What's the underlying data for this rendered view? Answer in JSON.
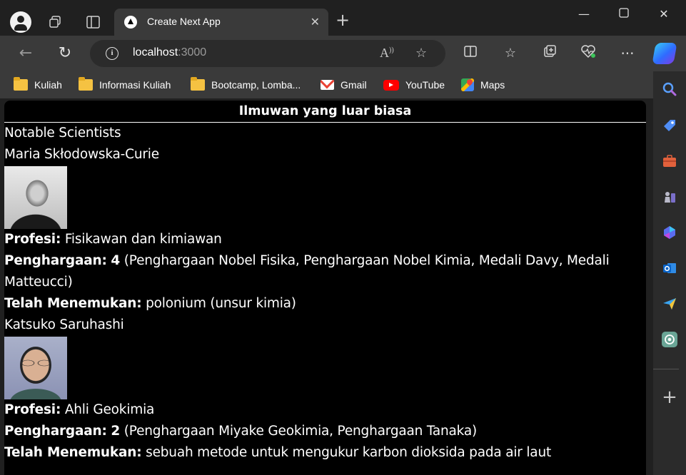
{
  "browser": {
    "tab_title": "Create Next App",
    "url_host": "localhost",
    "url_port": ":3000",
    "bookmarks": [
      {
        "label": "Kuliah",
        "icon": "folder-icon"
      },
      {
        "label": "Informasi Kuliah",
        "icon": "folder-icon"
      },
      {
        "label": "Bootcamp, Lomba...",
        "icon": "folder-icon"
      },
      {
        "label": "Gmail",
        "icon": "gmail-icon"
      },
      {
        "label": "YouTube",
        "icon": "youtube-icon"
      },
      {
        "label": "Maps",
        "icon": "maps-icon"
      }
    ]
  },
  "page": {
    "header": "Ilmuwan yang luar biasa",
    "heading": "Notable Scientists",
    "labels": {
      "profession": "Profesi:",
      "awards": "Penghargaan:",
      "discovered": "Telah Menemukan:"
    },
    "scientists": [
      {
        "name": "Maria Skłodowska-Curie",
        "profession": "Fisikawan dan kimiawan",
        "awards_count": "4",
        "awards_list": "(Penghargaan Nobel Fisika, Penghargaan Nobel Kimia, Medali Davy, Medali Matteucci)",
        "discovered": "polonium (unsur kimia)"
      },
      {
        "name": "Katsuko Saruhashi",
        "profession": "Ahli Geokimia",
        "awards_count": "2",
        "awards_list": "(Penghargaan Miyake Geokimia, Penghargaan Tanaka)",
        "discovered": "sebuah metode untuk mengukur karbon dioksida pada air laut"
      }
    ]
  }
}
